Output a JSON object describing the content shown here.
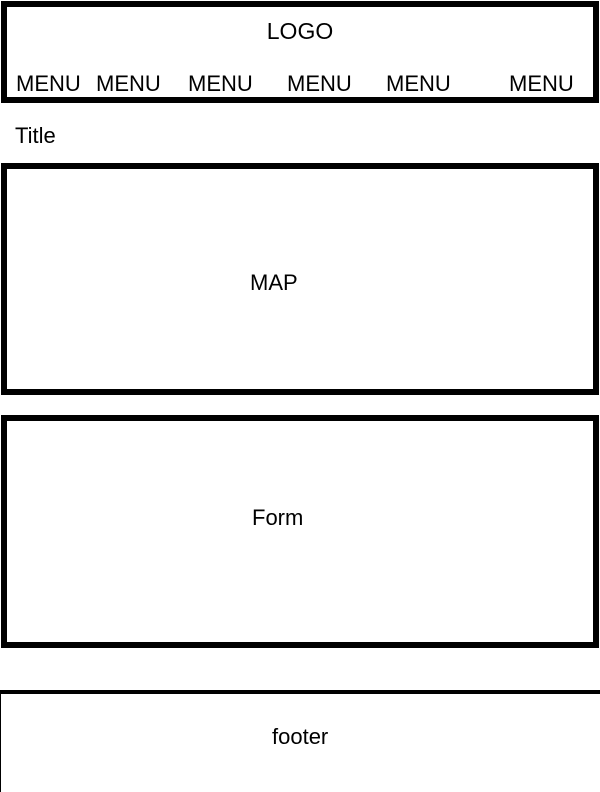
{
  "header": {
    "logo": "LOGO",
    "menu_items": [
      "MENU",
      "MENU",
      "MENU",
      "MENU",
      "MENU",
      "MENU"
    ]
  },
  "title": "Title",
  "map": {
    "label": "MAP"
  },
  "form": {
    "label": "Form"
  },
  "footer": {
    "label": "footer"
  }
}
